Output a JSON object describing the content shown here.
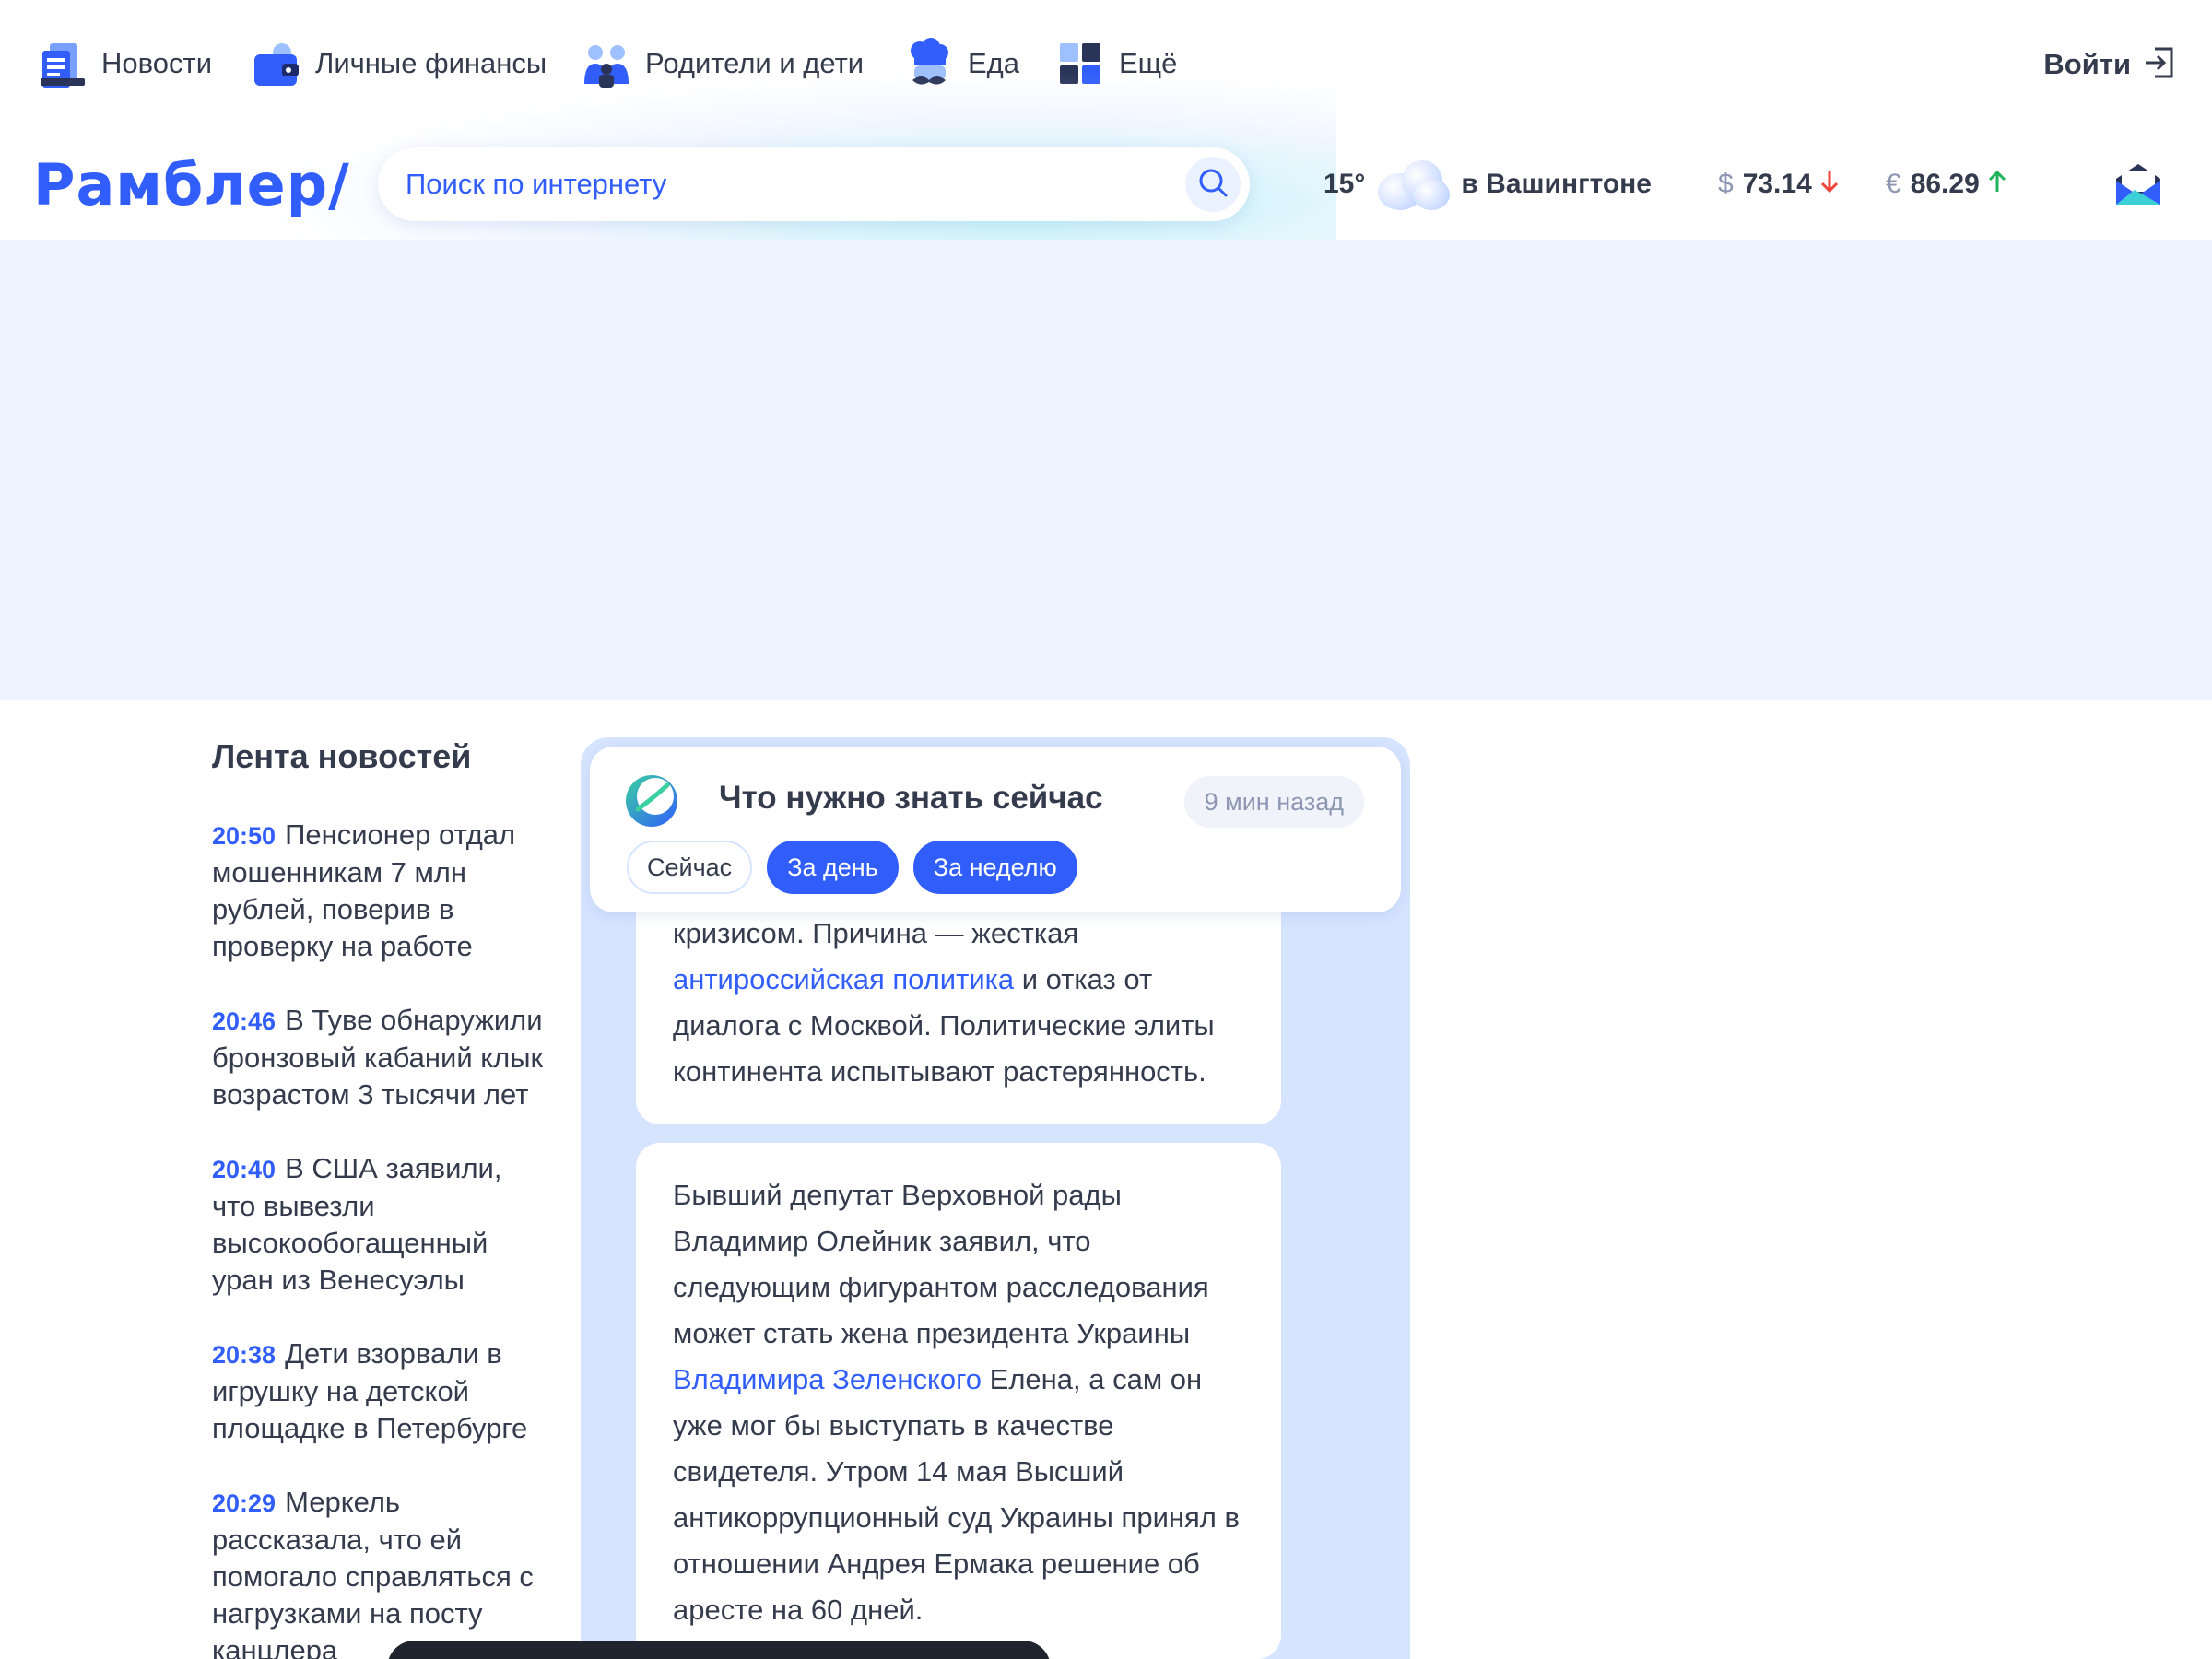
{
  "nav": {
    "items": [
      {
        "label": "Новости",
        "icon": "news-icon"
      },
      {
        "label": "Личные финансы",
        "icon": "wallet-icon"
      },
      {
        "label": "Родители и дети",
        "icon": "family-icon"
      },
      {
        "label": "Еда",
        "icon": "chef-icon"
      },
      {
        "label": "Ещё",
        "icon": "grid-icon"
      }
    ],
    "login_label": "Войти"
  },
  "header": {
    "logo": "Рамблер/",
    "search_placeholder": "Поиск по интернету",
    "weather": {
      "temp": "15°",
      "city": "в Вашингтоне"
    },
    "rates": [
      {
        "currency": "$",
        "value": "73.14",
        "trend": "down",
        "color": "#f0433b"
      },
      {
        "currency": "€",
        "value": "86.29",
        "trend": "up",
        "color": "#1fb35a"
      }
    ]
  },
  "feed": {
    "title": "Лента новостей",
    "items": [
      {
        "time": "20:50",
        "text": "Пенсионер отдал мошенникам 7 млн рублей, поверив в проверку на работе"
      },
      {
        "time": "20:46",
        "text": "В Туве обнаружили бронзовый кабаний клык возрастом 3 тысячи лет"
      },
      {
        "time": "20:40",
        "text": "В США заявили, что вывезли высокообогащенный уран из Венесуэлы"
      },
      {
        "time": "20:38",
        "text": "Дети взорвали в игрушку на детской площадке в Петербурге"
      },
      {
        "time": "20:29",
        "text": "Меркель рассказала, что ей помогало справляться с нагрузками на посту канцлера"
      }
    ]
  },
  "widget": {
    "title": "Что нужно знать сейчас",
    "time": "9 мин назад",
    "tabs": [
      "Сейчас",
      "За день",
      "За неделю"
    ],
    "card1": {
      "before": "кризисом. Причина — жесткая ",
      "link": "антироссийская политика",
      "after": " и отказ от диалога с Москвой. Политические элиты континента испытывают растерянность."
    },
    "card2": {
      "before": "Бывший депутат Верховной рады Владимир Олейник заявил, что следующим фигурантом расследования может стать жена президента Украины ",
      "link": "Владимира Зеленского",
      "after": " Елена, а сам он уже мог бы выступать в качестве свидетеля. Утром 14 мая Высший антикоррупционный суд Украины принял в отношении Андрея Ермака решение об аресте на 60 дней."
    }
  },
  "colors": {
    "accent": "#315efb",
    "ad_bg": "#eef4ff",
    "widget_bg": "#d6e4ff",
    "text": "#343b4c"
  }
}
